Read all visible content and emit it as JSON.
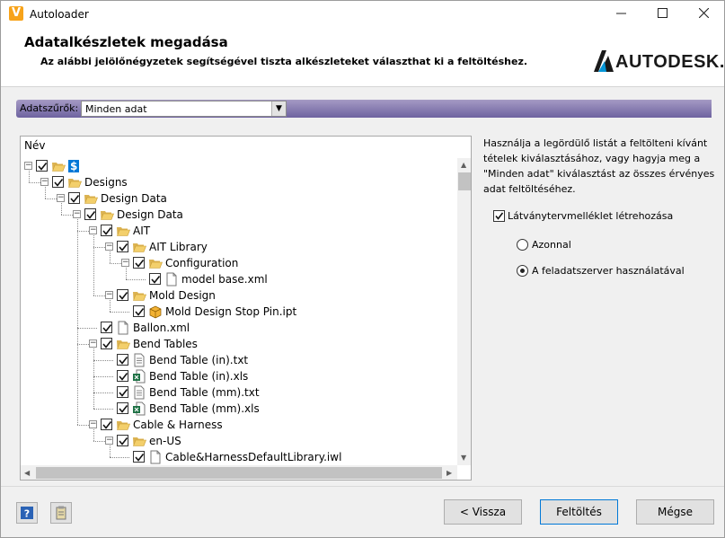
{
  "window": {
    "title": "Autoloader",
    "icon": "autodesk-v-icon"
  },
  "header": {
    "title": "Adatalkészletek megadása",
    "subtitle": "Az alábbi jelölőnégyzetek segítségével tiszta alkészleteket választhat ki a feltöltéshez.",
    "logo_text": "AUTODESK."
  },
  "filter": {
    "label": "Adatszűrők:",
    "value": "Minden adat"
  },
  "tree": {
    "column_header": "Név",
    "items": [
      {
        "label": "$",
        "icon": "folder-open-icon",
        "checked": true,
        "level": 0,
        "expandable": true
      },
      {
        "label": "Designs",
        "icon": "folder-open-icon",
        "checked": true,
        "level": 1,
        "expandable": true
      },
      {
        "label": "Design Data",
        "icon": "folder-open-icon",
        "checked": true,
        "level": 2,
        "expandable": true
      },
      {
        "label": "Design Data",
        "icon": "folder-open-icon",
        "checked": true,
        "level": 3,
        "expandable": true
      },
      {
        "label": "AIT",
        "icon": "folder-open-icon",
        "checked": true,
        "level": 4,
        "expandable": true
      },
      {
        "label": "AIT Library",
        "icon": "folder-open-icon",
        "checked": true,
        "level": 5,
        "expandable": true
      },
      {
        "label": "Configuration",
        "icon": "folder-open-icon",
        "checked": true,
        "level": 6,
        "expandable": true
      },
      {
        "label": "model base.xml",
        "icon": "file-icon",
        "checked": true,
        "level": 7,
        "expandable": false
      },
      {
        "label": "Mold Design",
        "icon": "folder-open-icon",
        "checked": true,
        "level": 5,
        "expandable": true
      },
      {
        "label": "Mold Design Stop Pin.ipt",
        "icon": "part-icon",
        "checked": true,
        "level": 6,
        "expandable": false
      },
      {
        "label": "Ballon.xml",
        "icon": "file-icon",
        "checked": true,
        "level": 4,
        "expandable": false
      },
      {
        "label": "Bend Tables",
        "icon": "folder-open-icon",
        "checked": true,
        "level": 4,
        "expandable": true
      },
      {
        "label": "Bend Table (in).txt",
        "icon": "text-file-icon",
        "checked": true,
        "level": 5,
        "expandable": false
      },
      {
        "label": "Bend Table (in).xls",
        "icon": "excel-file-icon",
        "checked": true,
        "level": 5,
        "expandable": false
      },
      {
        "label": "Bend Table (mm).txt",
        "icon": "text-file-icon",
        "checked": true,
        "level": 5,
        "expandable": false
      },
      {
        "label": "Bend Table (mm).xls",
        "icon": "excel-file-icon",
        "checked": true,
        "level": 5,
        "expandable": false
      },
      {
        "label": "Cable & Harness",
        "icon": "folder-open-icon",
        "checked": true,
        "level": 4,
        "expandable": true
      },
      {
        "label": "en-US",
        "icon": "folder-open-icon",
        "checked": true,
        "level": 5,
        "expandable": true
      },
      {
        "label": "Cable&HarnessDefaultLibrary.iwl",
        "icon": "file-icon",
        "checked": true,
        "level": 6,
        "expandable": false
      }
    ]
  },
  "help": {
    "text": "Használja a legördülő listát a feltölteni kívánt tételek kiválasztásához, vagy hagyja meg a \"Minden adat\" kiválasztást az összes érvényes adat feltöltéséhez.",
    "checkbox_label": "Látványtervmelléklet létrehozása",
    "radio_immediate": "Azonnal",
    "radio_jobserver": "A feladatszerver használatával"
  },
  "footer": {
    "back_label": "< Vissza",
    "upload_label": "Feltöltés",
    "cancel_label": "Mégse"
  }
}
